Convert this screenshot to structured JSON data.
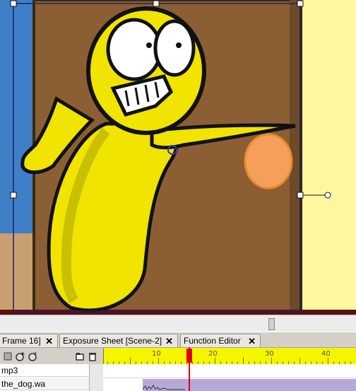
{
  "tabs": [
    {
      "label": "Frame 16]",
      "close": "✕"
    },
    {
      "label": "Exposure Sheet [Scene-2]",
      "close": "✕"
    },
    {
      "label": "Function Editor",
      "close": "✕"
    }
  ],
  "ruler": {
    "ticks": [
      "10",
      "20",
      "30",
      "40"
    ]
  },
  "layers": [
    {
      "name": "mp3"
    },
    {
      "name": "the_dog.wa"
    }
  ],
  "icons": {
    "tool1": "layers-icon",
    "tool2": "add-layer-icon",
    "tool3": "link-icon",
    "tool4": "folder-icon",
    "tool5": "trash-icon"
  },
  "colors": {
    "ruler_bg": "#f5f500",
    "playhead": "#e00000",
    "audio_clip": "#b8a8d8",
    "character": "#f0e400",
    "door": "#8b5e34"
  }
}
